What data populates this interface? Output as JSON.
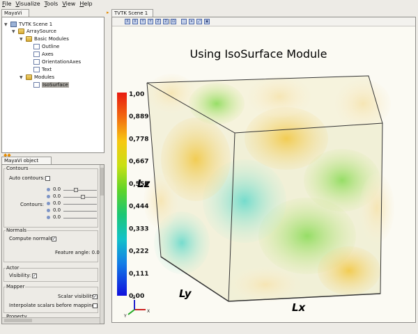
{
  "menubar": [
    {
      "u": "F",
      "rest": "ile"
    },
    {
      "u": "V",
      "rest": "isualize"
    },
    {
      "u": "T",
      "rest": "ools"
    },
    {
      "u": "V",
      "rest": "iew"
    },
    {
      "u": "H",
      "rest": "elp"
    }
  ],
  "tabs": {
    "mayavi": "MayaVi",
    "scene": "TVTK Scene 1",
    "editor": "MayaVi object editor"
  },
  "tree": [
    {
      "label": "TVTK Scene 1",
      "icon": "scene-icon",
      "expanded": true
    },
    {
      "label": "ArraySource",
      "icon": "folder-icon",
      "expanded": true
    },
    {
      "label": "Basic Modules",
      "icon": "folder-icon",
      "expanded": true
    },
    {
      "label": "Outline",
      "icon": "document-icon"
    },
    {
      "label": "Axes",
      "icon": "document-icon"
    },
    {
      "label": "OrientationAxes",
      "icon": "document-icon"
    },
    {
      "label": "Text",
      "icon": "document-icon"
    },
    {
      "label": "Modules",
      "icon": "folder-icon",
      "expanded": true
    },
    {
      "label": "IsoSurface",
      "icon": "document-icon",
      "selected": true
    }
  ],
  "editor": {
    "contours_group": "Contours",
    "auto_contours_label": "Auto contours:",
    "auto_contours_checked": false,
    "contours_label": "Contours:",
    "contour_values": [
      "0.0",
      "0.0",
      "0.0",
      "0.0",
      "0.0"
    ],
    "contour_levels": [
      0.35,
      0.6,
      0.0,
      0.0,
      0.0
    ],
    "normals_group": "Normals",
    "compute_normals_label": "Compute normals:",
    "compute_normals_checked": true,
    "feature_angle_label": "Feature angle: 0.000",
    "actor_group": "Actor",
    "visibility_label": "Visibility:",
    "visibility_checked": true,
    "mapper_group": "Mapper",
    "scalar_visibility_label": "Scalar visibility:",
    "scalar_visibility_checked": true,
    "interpolate_label": "Interpolate scalars before mapping:",
    "interpolate_checked": false,
    "property_group": "Property"
  },
  "scene": {
    "title": "Using IsoSurface Module",
    "axis_x": "Lx",
    "axis_y": "Ly",
    "axis_z": "Lz",
    "orientation_x": "X",
    "orientation_y": "Y",
    "orientation_z": "Z",
    "colorbar_labels": [
      "1,00",
      "0,889",
      "0,778",
      "0,667",
      "0,556",
      "0,444",
      "0,333",
      "0,222",
      "0,111",
      "0,00"
    ],
    "colors": {
      "title": "#222222",
      "outline": "#333333",
      "axis_x": "#cc2222",
      "axis_y": "#22aa22",
      "axis_z": "#2222cc"
    }
  },
  "toolbar_icons": [
    "view-x-plus-icon",
    "view-x-minus-icon",
    "view-y-plus-icon",
    "view-y-minus-icon",
    "view-z-plus-icon",
    "view-z-minus-icon",
    "isometric-view-icon",
    "parallel-projection-icon",
    "axes-toggle-icon",
    "fullscreen-icon",
    "save-icon"
  ]
}
